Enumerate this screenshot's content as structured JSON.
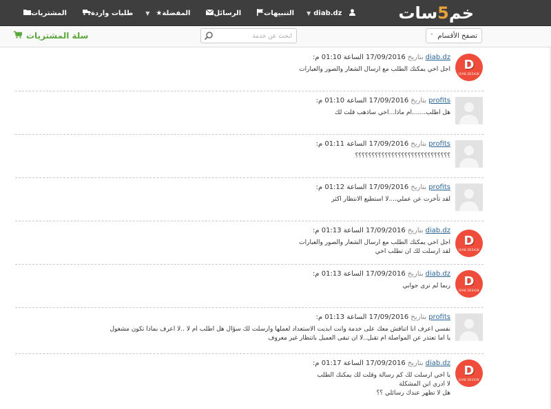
{
  "nav": {
    "logo_main": "خم",
    "logo_five": "5",
    "logo_end": "سات",
    "items": [
      {
        "label": "المشتريات",
        "icon": "folder-icon"
      },
      {
        "label": "طلبات واردة",
        "icon": "truck-icon"
      },
      {
        "label": "المفضلة",
        "icon": "star-icon"
      },
      {
        "label": "الرسائل",
        "icon": "envelope-icon"
      },
      {
        "label": "التنبيهات",
        "icon": "flag-icon"
      },
      {
        "label": "diab.dz",
        "icon": "user-icon"
      }
    ]
  },
  "subbar": {
    "cart_label": "سلة المشتريات",
    "search_placeholder": "ابحث عن خدمة",
    "browse_label": "تصفح الأقسام"
  },
  "messages": [
    {
      "user": "diab.dz",
      "avatar": "logo",
      "meta": "بتاريخ",
      "date": "17/09/2016 الساعة 01:10 م:",
      "lines": [
        "اجل اخي يمكنك الطلب مع ارسال الشعار والصور والعبارات"
      ]
    },
    {
      "user": "profits",
      "avatar": "gray",
      "meta": "بتاريخ",
      "date": "17/09/2016 الساعة 01:10 م:",
      "lines": [
        "هل اطلب.......ام ماذا...اخي ساذهب قلت لك"
      ]
    },
    {
      "user": "profits",
      "avatar": "gray",
      "meta": "بتاريخ",
      "date": "17/09/2016 الساعة 01:11 م:",
      "lines": [
        "؟؟؟؟؟؟؟؟؟؟؟؟؟؟؟؟؟؟؟؟؟؟؟؟؟؟؟؟؟"
      ]
    },
    {
      "user": "profits",
      "avatar": "gray",
      "meta": "بتاريخ",
      "date": "17/09/2016 الساعة 01:12 م:",
      "lines": [
        "لقد تأخرت عن عملي....لا استطيع الانتظار اكثر"
      ]
    },
    {
      "user": "diab.dz",
      "avatar": "logo",
      "meta": "بتاريخ",
      "date": "17/09/2016 الساعة 01:13 م:",
      "lines": [
        "اجل اخي يمكنك الطلب مع ارسال الشعار والصور والعبارات",
        "لقد ارسلت لك ان تطلب اخي"
      ]
    },
    {
      "user": "diab.dz",
      "avatar": "logo",
      "meta": "بتاريخ",
      "date": "17/09/2016 الساعة 01:13 م:",
      "lines": [
        "ربما لم ترى جوابي"
      ]
    },
    {
      "user": "profits",
      "avatar": "gray",
      "meta": "بتاريخ",
      "date": "17/09/2016 الساعة 01:13 م:",
      "lines": [
        "نفسي اعرف انا اتناقش معك على خدمة وانت ابديت الاستعداد لعملها وارسلت لك سؤال هل اطلب ام لا ..لا اعرف بماذا تكون مشغول",
        "يا اما تعتذر عن المواصلة ام تقبل..لا ان تبقى العميل بانتظار غير معروف"
      ]
    },
    {
      "user": "diab.dz",
      "avatar": "logo",
      "meta": "بتاريخ",
      "date": "17/09/2016 الساعة 01:17 م:",
      "lines": [
        "يا اخي ارسلت لك كم رسالة وقلت لك يمكنك الطلب",
        "لا ادري اين المشكلة",
        "هل لا تظهر عندك رسائلي ؟؟"
      ]
    }
  ],
  "avatar_text": {
    "letter": "D",
    "caption": "DIAB DESIGN"
  }
}
